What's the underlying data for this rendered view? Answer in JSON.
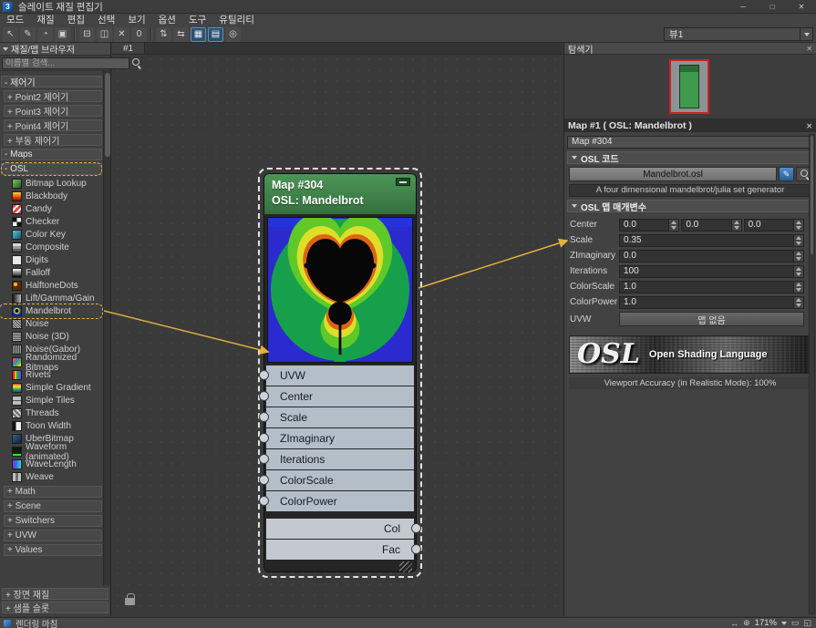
{
  "window": {
    "title": "슬레이트 재질 편집기",
    "logo": "3",
    "controls": {
      "min": "─",
      "max": "□",
      "close": "✕"
    }
  },
  "menu": {
    "items": [
      {
        "label": "모드",
        "name": "menu-mode"
      },
      {
        "label": "재질",
        "name": "menu-material"
      },
      {
        "label": "편집",
        "name": "menu-edit"
      },
      {
        "label": "선택",
        "name": "menu-select"
      },
      {
        "label": "보기",
        "name": "menu-view"
      },
      {
        "label": "옵션",
        "name": "menu-options"
      },
      {
        "label": "도구",
        "name": "menu-tools"
      },
      {
        "label": "유틸리티",
        "name": "menu-utilities"
      }
    ]
  },
  "toolbar": {
    "view_selector": "뷰1",
    "buttons": [
      {
        "glyph": "↖",
        "name": "select-tool-button"
      },
      {
        "glyph": "✎",
        "name": "pick-material-button"
      },
      {
        "glyph": "◔",
        "name": "put-to-library-button"
      },
      {
        "glyph": "▣",
        "name": "assign-material-to-selection-button"
      },
      {
        "sep": true
      },
      {
        "glyph": "⊟",
        "name": "show-end-result-button"
      },
      {
        "glyph": "◫",
        "name": "show-shaded-material-button"
      },
      {
        "glyph": "✕",
        "name": "delete-selected-button"
      },
      {
        "glyph": "0",
        "name": "show-background-button"
      },
      {
        "sep": true
      },
      {
        "glyph": "⇅",
        "name": "move-children-button"
      },
      {
        "glyph": "⇆",
        "name": "arrange-children-button"
      },
      {
        "glyph": "▦",
        "name": "layout-all-vertical-button",
        "active": true
      },
      {
        "glyph": "▤",
        "name": "layout-children-button",
        "active": true
      },
      {
        "glyph": "◎",
        "name": "material-preview-button"
      }
    ]
  },
  "browser": {
    "title": "재질/맵 브라우저",
    "search_placeholder": "이름별 검색...",
    "rows": [
      {
        "kind": "section",
        "text": "- 제어기"
      },
      {
        "kind": "group",
        "text": "+ Point2 제어기"
      },
      {
        "kind": "group",
        "text": "+ Point3 제어기"
      },
      {
        "kind": "group",
        "text": "+ Point4 제어기"
      },
      {
        "kind": "group",
        "text": "+ 부동 제어기"
      },
      {
        "kind": "section",
        "text": "- Maps"
      },
      {
        "kind": "section",
        "text": "- OSL",
        "hl": true
      },
      {
        "kind": "map",
        "icon": "bitmap-lookup",
        "text": "Bitmap Lookup"
      },
      {
        "kind": "map",
        "icon": "blackbody",
        "text": "Blackbody"
      },
      {
        "kind": "map",
        "icon": "candy",
        "text": "Candy"
      },
      {
        "kind": "map",
        "icon": "checker",
        "text": "Checker"
      },
      {
        "kind": "map",
        "icon": "color-key",
        "text": "Color Key"
      },
      {
        "kind": "map",
        "icon": "composite",
        "text": "Composite"
      },
      {
        "kind": "map",
        "icon": "digits",
        "text": "Digits"
      },
      {
        "kind": "map",
        "icon": "falloff",
        "text": "Falloff"
      },
      {
        "kind": "map",
        "icon": "halftone-dots",
        "text": "HalftoneDots"
      },
      {
        "kind": "map",
        "icon": "lift-gamma-gain",
        "text": "Lift/Gamma/Gain"
      },
      {
        "kind": "map",
        "icon": "mandelbrot",
        "text": "Mandelbrot",
        "hl": true
      },
      {
        "kind": "map",
        "icon": "noise",
        "text": "Noise"
      },
      {
        "kind": "map",
        "icon": "noise-3d",
        "text": "Noise (3D)"
      },
      {
        "kind": "map",
        "icon": "noise-gabor",
        "text": "Noise(Gabor)"
      },
      {
        "kind": "map",
        "icon": "randomized-bitmaps",
        "text": "Randomized Bitmaps"
      },
      {
        "kind": "map",
        "icon": "rivets",
        "text": "Rivets"
      },
      {
        "kind": "map",
        "icon": "simple-gradient",
        "text": "Simple Gradient"
      },
      {
        "kind": "map",
        "icon": "simple-tiles",
        "text": "Simple Tiles"
      },
      {
        "kind": "map",
        "icon": "threads",
        "text": "Threads"
      },
      {
        "kind": "map",
        "icon": "toon-width",
        "text": "Toon Width"
      },
      {
        "kind": "map",
        "icon": "uber-bitmap",
        "text": "UberBitmap"
      },
      {
        "kind": "map",
        "icon": "waveform-animated",
        "text": "Waveform (animated)"
      },
      {
        "kind": "map",
        "icon": "wavelength",
        "text": "WaveLength"
      },
      {
        "kind": "map",
        "icon": "weave",
        "text": "Weave"
      },
      {
        "kind": "group",
        "text": "+ Math"
      },
      {
        "kind": "group",
        "text": "+ Scene"
      },
      {
        "kind": "group",
        "text": "+ Switchers"
      },
      {
        "kind": "group",
        "text": "+ UVW"
      },
      {
        "kind": "group",
        "text": "+ Values"
      }
    ],
    "footer_rows": [
      {
        "text": "+ 장면 재질",
        "name": "scene-materials-group"
      },
      {
        "text": "+ 샘플 슬롯",
        "name": "sample-slots-group"
      }
    ]
  },
  "canvas": {
    "tab": "#1"
  },
  "node": {
    "title_line1": "Map #304",
    "title_line2": "OSL: Mandelbrot",
    "inputs": [
      "UVW",
      "Center",
      "Scale",
      "ZImaginary",
      "Iterations",
      "ColorScale",
      "ColorPower"
    ],
    "outputs": [
      "Col",
      "Fac"
    ]
  },
  "navigator": {
    "title": "탐색기",
    "close": "✕"
  },
  "inspector": {
    "header": "Map #1  ( OSL: Mandelbrot )",
    "close": "✕",
    "name_field": "Map #304",
    "code_rollout": "OSL 코드",
    "shader_file": "Mandelbrot.osl",
    "open_editor_glyph": "✎",
    "description": "A four dimensional mandelbrot/julia set generator",
    "params_rollout": "OSL 맵 매개변수",
    "center_label": "Center",
    "center_values": [
      "0.0",
      "0.0",
      "0.0"
    ],
    "rows": [
      {
        "label": "Scale",
        "value": "0.35"
      },
      {
        "label": "ZImaginary",
        "value": "0.0"
      },
      {
        "label": "Iterations",
        "value": "100"
      },
      {
        "label": "ColorScale",
        "value": "1.0"
      },
      {
        "label": "ColorPower",
        "value": "1.0"
      }
    ],
    "uvw_label": "UVW",
    "uvw_button": "맵 없음",
    "logo_osl": "OSL",
    "logo_text": "Open Shading Language",
    "viewport_accuracy": "Viewport Accuracy (in Realistic Mode): 100%"
  },
  "statusbar": {
    "message": "렌더링 마침",
    "zoom": "171%",
    "icons": [
      {
        "glyph": "↔",
        "name": "pan-icon"
      },
      {
        "glyph": "⊕",
        "name": "zoom-icon"
      }
    ],
    "icons_after": [
      {
        "glyph": "▭",
        "name": "zoom-region-icon"
      },
      {
        "glyph": "◱",
        "name": "fit-view-icon"
      }
    ]
  },
  "colors": {
    "accent_yellow": "#e2b13c",
    "node_header_green": "#4c9556",
    "selection_red": "#cf2020"
  }
}
